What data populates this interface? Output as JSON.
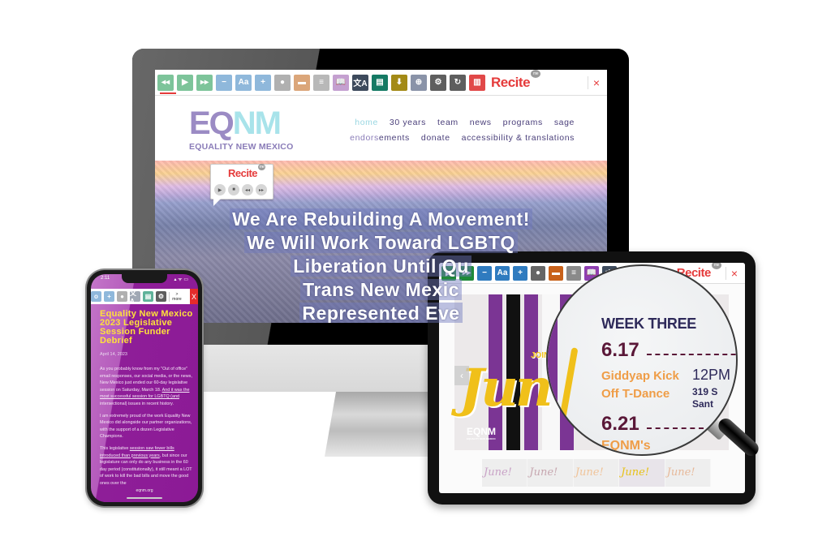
{
  "recite_toolbar": {
    "brand": "Recite",
    "brand_badge": "me",
    "close_glyph": "×",
    "buttons": [
      {
        "name": "rewind-icon",
        "glyph": "◂◂",
        "color": "#7dc49a"
      },
      {
        "name": "play-icon",
        "glyph": "▶",
        "color": "#7dc49a"
      },
      {
        "name": "fast-forward-icon",
        "glyph": "▸▸",
        "color": "#7dc49a"
      },
      {
        "name": "decrease-text-icon",
        "glyph": "−",
        "color": "#8fb8db"
      },
      {
        "name": "font-icon",
        "glyph": "Aa",
        "color": "#8fb8db"
      },
      {
        "name": "increase-text-icon",
        "glyph": "+",
        "color": "#8fb8db"
      },
      {
        "name": "color-wheel-icon",
        "glyph": "●",
        "color": "#b0b0b0"
      },
      {
        "name": "ruler-icon",
        "glyph": "▬",
        "color": "#dba67a"
      },
      {
        "name": "screen-mask-icon",
        "glyph": "≡",
        "color": "#b8b8b8"
      },
      {
        "name": "dictionary-icon",
        "glyph": "📖",
        "color": "#c4a0d0"
      },
      {
        "name": "translate-icon",
        "glyph": "文A",
        "color": "#3d4a5c"
      },
      {
        "name": "reader-icon",
        "glyph": "▤",
        "color": "#157a64"
      },
      {
        "name": "download-icon",
        "glyph": "⬇",
        "color": "#a38a16"
      },
      {
        "name": "magnifier-icon",
        "glyph": "⊕",
        "color": "#8a93a8"
      },
      {
        "name": "settings-icon",
        "glyph": "⚙",
        "color": "#5e5e5e"
      },
      {
        "name": "reset-icon",
        "glyph": "↻",
        "color": "#5e5e5e"
      },
      {
        "name": "docs-icon",
        "glyph": "▥",
        "color": "#e14848"
      }
    ]
  },
  "desktop": {
    "logo": {
      "mark_left": "EQ",
      "mark_right": "NM",
      "subtitle": "EQUALITY NEW MEXICO"
    },
    "nav_row1": [
      "home",
      "30 years",
      "team",
      "news",
      "programs",
      "sage"
    ],
    "nav_row2": [
      "endorsements",
      "donate",
      "accessibility & translations"
    ],
    "active_nav": "home",
    "hero_lines": [
      "We Are Rebuilding A Movement!",
      "We Will Work Toward LGBTQ",
      "Liberation Until Qu",
      "Trans New Mexic",
      "Represented Eve"
    ],
    "popup": {
      "brand": "Recite",
      "badge": "me",
      "controls": [
        "▶",
        "■",
        "◂◂",
        "▸▸"
      ]
    }
  },
  "phone": {
    "status_time": "2:11",
    "status_icons": "▴ ᯤ ▭",
    "toolbar": {
      "buttons": [
        {
          "name": "decrease-text-icon",
          "glyph": "o",
          "color": "#8fb8db"
        },
        {
          "name": "increase-text-icon",
          "glyph": "+",
          "color": "#8fb8db"
        },
        {
          "name": "color-wheel-icon",
          "glyph": "●",
          "color": "#b0b0b0"
        },
        {
          "name": "translate-icon",
          "glyph": "文A",
          "color": "#a0a8b4"
        },
        {
          "name": "reader-icon",
          "glyph": "▤",
          "color": "#5fb29a"
        },
        {
          "name": "settings-icon",
          "glyph": "⚙",
          "color": "#5e5e5e"
        }
      ],
      "more_label": ">",
      "more_sub": "more",
      "close_glyph": "X"
    },
    "title": "Equality New Mexico 2023 Legislative Session Funder Debrief",
    "date": "April 14, 2023",
    "paragraphs": [
      {
        "before": "As you probably know from my \"Out of office\" email responses, our social media, or the news, New Mexico just ended our 60-day legislative session on Saturday, March 18. ",
        "link": "And it was the most successful session for LGBTQ (and",
        "after": " intersectional) issues in recent history."
      },
      {
        "before": "I am extremely proud of the work Equality New Mexico did alongside our partner organizations, with the support of a dozen Legislative Champions.",
        "link": "",
        "after": ""
      },
      {
        "before": "This legislative ",
        "link": "session saw fewer bills introduced than previous years",
        "after": ", but since our legislature can only do any business in the 60 day period (constitutionally), it still meant a LOT of work to kill the bad bills and move the good ones over the"
      }
    ],
    "url": "eqnm.org"
  },
  "tablet": {
    "toolbar": {
      "buttons": [
        {
          "name": "play-icon",
          "glyph": "▶",
          "color": "#1f8a3a"
        },
        {
          "name": "fast-forward-icon",
          "glyph": "▸▸",
          "color": "#1f8a3a"
        },
        {
          "name": "decrease-text-icon",
          "glyph": "−",
          "color": "#2f7bbf"
        },
        {
          "name": "font-icon",
          "glyph": "Aa",
          "color": "#2f7bbf"
        },
        {
          "name": "increase-text-icon",
          "glyph": "+",
          "color": "#2f7bbf"
        },
        {
          "name": "color-wheel-icon",
          "glyph": "●",
          "color": "#666666"
        },
        {
          "name": "ruler-icon",
          "glyph": "▬",
          "color": "#c8611a"
        },
        {
          "name": "screen-mask-icon",
          "glyph": "≡",
          "color": "#8a8a8a"
        },
        {
          "name": "dictionary-icon",
          "glyph": "📖",
          "color": "#8e3fb0"
        },
        {
          "name": "translate-icon",
          "glyph": "文",
          "color": "#3d4a5c"
        }
      ],
      "brand": "Recite",
      "badge": "me",
      "close_glyph": "×"
    },
    "flyer": {
      "join": "JOIN",
      "script": "Jun",
      "logo": "EQNM",
      "logo_sub": "EQUALITY NEW MEXICO",
      "prev_glyph": "‹"
    },
    "thumbnails": [
      "June!",
      "June!",
      "June!",
      "June!",
      "June!"
    ],
    "magnified": {
      "heading": "WEEK THREE",
      "date1": "6.17",
      "event1_line1": "Giddyap Kick",
      "event1_line2": "Off T-Dance",
      "time1": "12PM",
      "addr1_line1": "319 S",
      "addr1_line2": "Sant",
      "date2": "6.21",
      "event2": "EQNM's"
    }
  }
}
